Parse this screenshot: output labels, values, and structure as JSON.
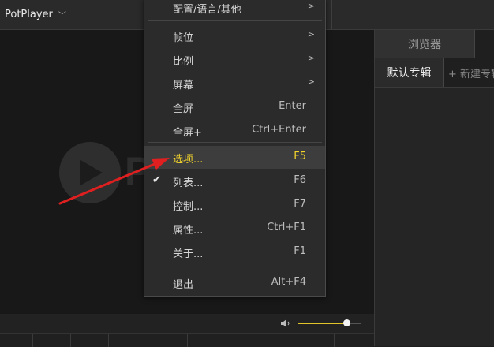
{
  "app": {
    "menu_button_label": "PotPlayer",
    "menu_button_chevron": "﹀"
  },
  "player": {
    "logo_letter": "P",
    "volume_level_fraction": 0.78
  },
  "right_panel": {
    "tab_browser": "浏览器",
    "tab_default_album": "默认专辑",
    "new_album": "+ 新建专辑"
  },
  "menu": {
    "items": [
      {
        "label": "配置/语言/其他",
        "shortcut": "",
        "submenu": true
      },
      {
        "label": "帧位",
        "shortcut": "",
        "submenu": true
      },
      {
        "label": "比例",
        "shortcut": "",
        "submenu": true
      },
      {
        "label": "屏幕",
        "shortcut": "",
        "submenu": true
      },
      {
        "label": "全屏",
        "shortcut": "Enter",
        "submenu": false
      },
      {
        "label": "全屏+",
        "shortcut": "Ctrl+Enter",
        "submenu": false
      },
      {
        "label": "选项...",
        "shortcut": "F5",
        "submenu": false,
        "highlighted": true
      },
      {
        "label": "列表...",
        "shortcut": "F6",
        "submenu": false,
        "checked": true
      },
      {
        "label": "控制...",
        "shortcut": "F7",
        "submenu": false
      },
      {
        "label": "属性...",
        "shortcut": "Ctrl+F1",
        "submenu": false
      },
      {
        "label": "关于...",
        "shortcut": "F1",
        "submenu": false
      },
      {
        "label": "退出",
        "shortcut": "Alt+F4",
        "submenu": false
      }
    ],
    "submenu_arrow": ">",
    "check_mark": "✔"
  },
  "colors": {
    "highlight_text": "#f2d42b",
    "annotation_arrow": "#e02020",
    "volume_fill": "#e2c42a"
  },
  "icons": {
    "volume": "speaker-icon",
    "check": "check-icon",
    "submenu": "chevron-right-icon",
    "annotation": "red-arrow-annotation"
  }
}
